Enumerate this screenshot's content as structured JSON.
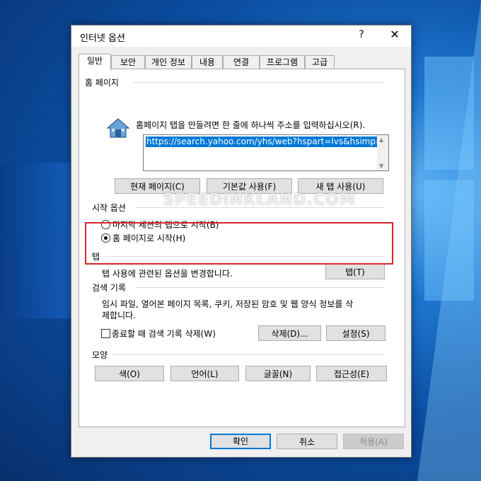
{
  "window": {
    "title": "인터넷 옵션",
    "help": "?",
    "close": "✕"
  },
  "tabs": [
    "일반",
    "보안",
    "개인 정보",
    "내용",
    "연결",
    "프로그램",
    "고급"
  ],
  "home_page": {
    "group": "홈 페이지",
    "instruction": "홈페이지 탭을 만들려면 한 줄에 하나씩 주소를 입력하십시오(R).",
    "url": "https://search.yahoo.com/yhs/web?hspart=lvs&hsimp=yhs-",
    "buttons": {
      "current": "현재 페이지(C)",
      "default": "기본값 사용(F)",
      "new_tab": "새 탭 사용(U)"
    }
  },
  "startup": {
    "group": "시작 옵션",
    "option1": "마지막 세션의 탭으로 시작(B)",
    "option2": "홈 페이지로 시작(H)"
  },
  "tabs_group": {
    "group": "탭",
    "desc": "탭 사용에 관련된 옵션을 변경합니다.",
    "button": "탭(T)"
  },
  "history": {
    "group": "검색 기록",
    "desc_line1": "임시 파일, 열어본 페이지 목록, 쿠키, 저장된 암호 및 웹 양식 정보를 삭",
    "desc_line2": "제합니다.",
    "checkbox": "종료할 때 검색 기록 삭제(W)",
    "delete": "삭제(D)...",
    "settings": "설정(S)"
  },
  "appearance": {
    "group": "모양",
    "colors": "색(O)",
    "languages": "언어(L)",
    "fonts": "글꼴(N)",
    "accessibility": "접근성(E)"
  },
  "footer": {
    "ok": "확인",
    "cancel": "취소",
    "apply": "적용(A)"
  },
  "watermark": "SPEEDINKLAND.COM",
  "colors": {
    "accent": "#0078d7",
    "highlight": "#d9262b"
  }
}
